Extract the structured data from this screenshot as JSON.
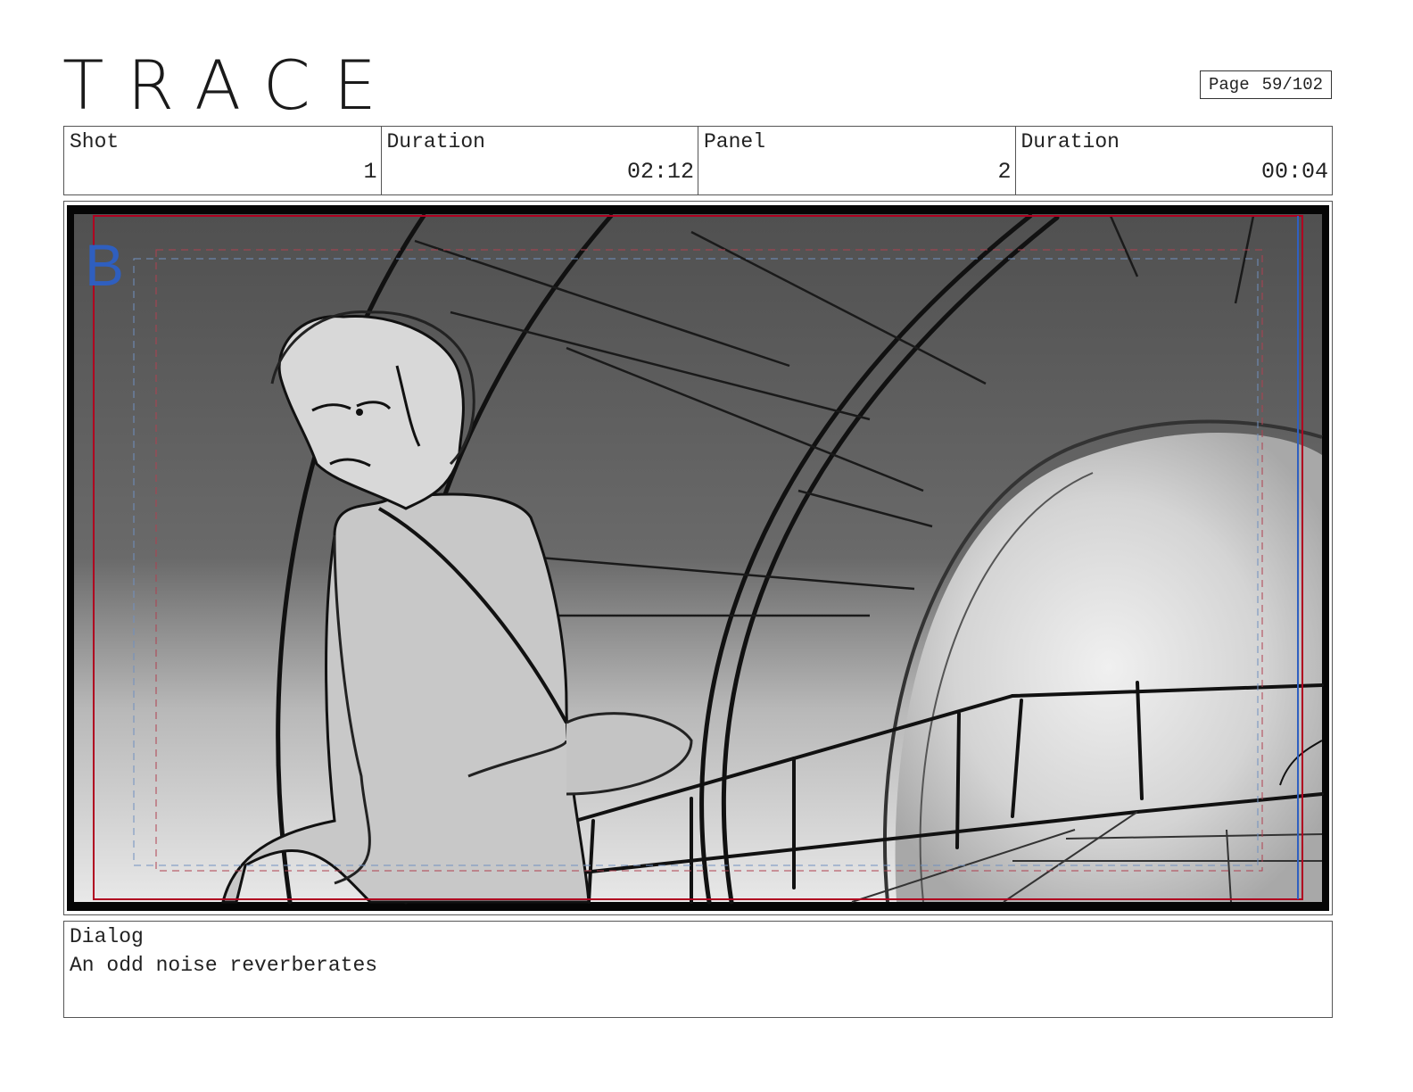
{
  "header": {
    "title": "TRACE",
    "page_label": "Page",
    "page_value": "59/102"
  },
  "info": {
    "shot_label": "Shot",
    "shot_value": "1",
    "shot_duration_label": "Duration",
    "shot_duration_value": "02:12",
    "panel_label": "Panel",
    "panel_value": "2",
    "panel_duration_label": "Duration",
    "panel_duration_value": "00:04"
  },
  "panel": {
    "safe_marker": "B",
    "illustration": "storyboard-sketch"
  },
  "dialog": {
    "label": "Dialog",
    "text": "An odd noise reverberates"
  }
}
